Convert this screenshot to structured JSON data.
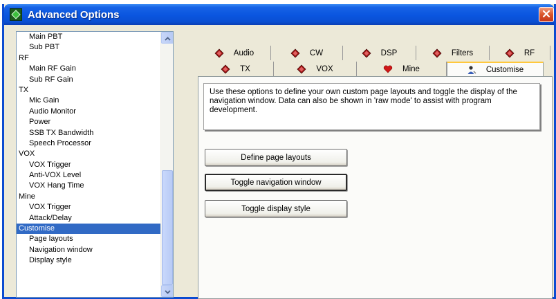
{
  "window": {
    "title": "Advanced Options",
    "icon": "app-diamond-icon",
    "close_icon": "close-icon"
  },
  "nav": {
    "items": [
      {
        "label": "Main PBT",
        "level": 1
      },
      {
        "label": "Sub PBT",
        "level": 1
      },
      {
        "label": "RF",
        "level": 0
      },
      {
        "label": "Main RF Gain",
        "level": 1
      },
      {
        "label": "Sub RF Gain",
        "level": 1
      },
      {
        "label": "TX",
        "level": 0
      },
      {
        "label": "Mic Gain",
        "level": 1
      },
      {
        "label": "Audio Monitor",
        "level": 1
      },
      {
        "label": "Power",
        "level": 1
      },
      {
        "label": "SSB TX Bandwidth",
        "level": 1
      },
      {
        "label": "Speech Processor",
        "level": 1
      },
      {
        "label": "VOX",
        "level": 0
      },
      {
        "label": "VOX Trigger",
        "level": 1
      },
      {
        "label": "Anti-VOX Level",
        "level": 1
      },
      {
        "label": "VOX Hang Time",
        "level": 1
      },
      {
        "label": "Mine",
        "level": 0
      },
      {
        "label": "VOX Trigger",
        "level": 1
      },
      {
        "label": "Attack/Delay",
        "level": 1
      },
      {
        "label": "Customise",
        "level": 0,
        "selected": true
      },
      {
        "label": "Page layouts",
        "level": 1
      },
      {
        "label": "Navigation window",
        "level": 1
      },
      {
        "label": "Display style",
        "level": 1
      }
    ],
    "selected_color": "#316ac5"
  },
  "tabs": {
    "row1": [
      {
        "label": "Audio",
        "icon": "red-diamond-icon"
      },
      {
        "label": "CW",
        "icon": "red-diamond-icon"
      },
      {
        "label": "DSP",
        "icon": "red-diamond-icon"
      },
      {
        "label": "Filters",
        "icon": "red-diamond-icon"
      },
      {
        "label": "RF",
        "icon": "red-diamond-icon"
      }
    ],
    "row2": [
      {
        "label": "TX",
        "icon": "red-diamond-icon"
      },
      {
        "label": "VOX",
        "icon": "red-diamond-icon"
      },
      {
        "label": "Mine",
        "icon": "heart-icon"
      },
      {
        "label": "Customise",
        "icon": "user-icon",
        "selected": true
      }
    ]
  },
  "customise": {
    "description": "Use these options to define your own custom page layouts and toggle the display of the navigation window. Data can also be shown in 'raw mode' to assist with program development.",
    "buttons": {
      "define_layouts": "Define page layouts",
      "toggle_nav": "Toggle navigation window",
      "toggle_style": "Toggle display style"
    }
  },
  "colors": {
    "titlebar": "#0a55df",
    "close": "#d9542a",
    "tab_highlight": "#ffc83c"
  }
}
